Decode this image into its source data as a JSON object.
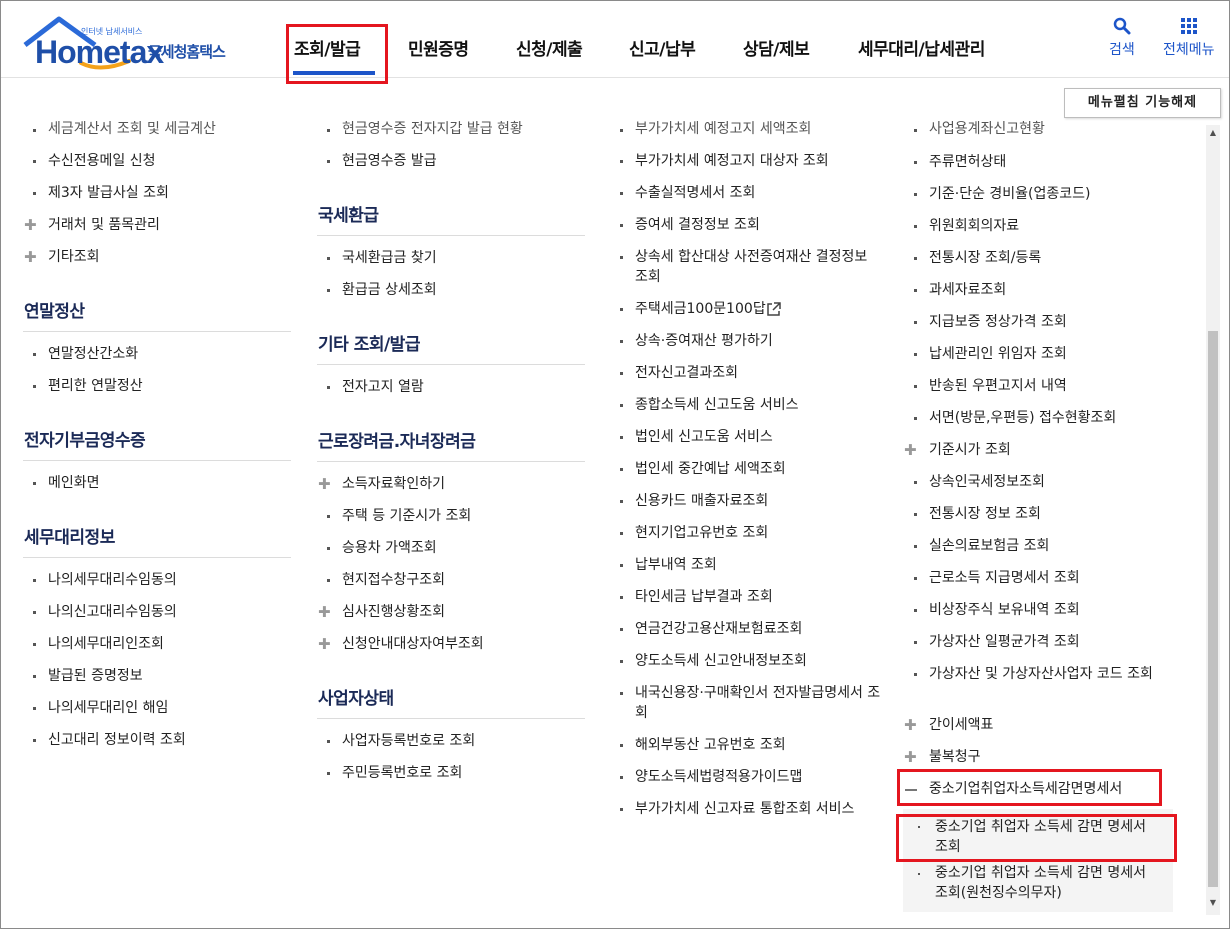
{
  "header": {
    "logo_small": "인터넷 납세서비스",
    "logo_word": "Hometax",
    "logo_ko": "국세청홈택스",
    "nav": [
      "조회/발급",
      "민원증명",
      "신청/제출",
      "신고/납부",
      "상담/제보",
      "세무대리/납세관리"
    ],
    "search_label": "검색",
    "menu_label": "전체메뉴",
    "collapse_button": "메뉴펼침 기능해제"
  },
  "col1": {
    "cut_top": "세금계산서 조회 및 세금계산",
    "items_a": [
      "수신전용메일 신청",
      "제3자 발급사실 조회",
      "거래처 및 품목관리",
      "기타조회"
    ],
    "sec1_title": "연말정산",
    "sec1_items": [
      "연말정산간소화",
      "편리한 연말정산"
    ],
    "sec2_title": "전자기부금영수증",
    "sec2_items": [
      "메인화면"
    ],
    "sec3_title": "세무대리정보",
    "sec3_items": [
      "나의세무대리수임동의",
      "나의신고대리수임동의",
      "나의세무대리인조회",
      "발급된 증명정보",
      "나의세무대리인 해임",
      "신고대리 정보이력 조회"
    ]
  },
  "col2": {
    "cut_top": "현금영수증 전자지갑 발급 현황",
    "items_a": [
      "현금영수증 발급"
    ],
    "sec1_title": "국세환급",
    "sec1_items": [
      "국세환급금 찾기",
      "환급금 상세조회"
    ],
    "sec2_title": "기타 조회/발급",
    "sec2_items": [
      "전자고지 열람"
    ],
    "sec3_title": "근로장려금.자녀장려금",
    "sec3_items": [
      "소득자료확인하기",
      "주택 등 기준시가 조회",
      "승용차 가액조회",
      "현지접수창구조회",
      "심사진행상황조회",
      "신청안내대상자여부조회"
    ],
    "sec4_title": "사업자상태",
    "sec4_items": [
      "사업자등록번호로 조회",
      "주민등록번호로 조회"
    ]
  },
  "col3": {
    "cut_top": "부가가치세 예정고지 세액조회",
    "items": [
      "부가가치세 예정고지 대상자 조회",
      "수출실적명세서 조회",
      "증여세 결정정보 조회",
      "상속세 합산대상 사전증여재산 결정정보 조회",
      "주택세금100문100답",
      "상속·증여재산 평가하기",
      "전자신고결과조회",
      "종합소득세 신고도움 서비스",
      "법인세 신고도움 서비스",
      "법인세 중간예납 세액조회",
      "신용카드 매출자료조회",
      "현지기업고유번호 조회",
      "납부내역 조회",
      "타인세금 납부결과 조회",
      "연금건강고용산재보험료조회",
      "양도소득세 신고안내정보조회",
      "내국신용장·구매확인서 전자발급명세서 조회",
      "해외부동산 고유번호 조회",
      "양도소득세법령적용가이드맵",
      "부가가치세 신고자료 통합조회 서비스"
    ]
  },
  "col4": {
    "cut_top": "사업용계좌신고현황",
    "items": [
      "주류면허상태",
      "기준·단순 경비율(업종코드)",
      "위원회회의자료",
      "전통시장 조회/등록",
      "과세자료조회",
      "지급보증 정상가격 조회",
      "납세관리인 위임자 조회",
      "반송된 우편고지서 내역",
      "서면(방문,우편등) 접수현황조회",
      "기준시가 조회",
      "상속인국세정보조회",
      "전통시장 정보 조회",
      "실손의료보험금 조회",
      "근로소득 지급명세서 조회",
      "비상장주식 보유내역 조회",
      "가상자산 일평균가격 조회",
      "가상자산 및 가상자산사업자 코드 조회",
      "간이세액표",
      "불복청구",
      "중소기업취업자소득세감면명세서"
    ],
    "sub_items": [
      "중소기업 취업자 소득세 감면 명세서 조회",
      "중소기업 취업자 소득세 감면 명세서 조회(원천징수의무자)"
    ]
  },
  "colors": {
    "accent": "#1d55c9",
    "highlight": "#e4161f",
    "section_title": "#1b2a57"
  }
}
